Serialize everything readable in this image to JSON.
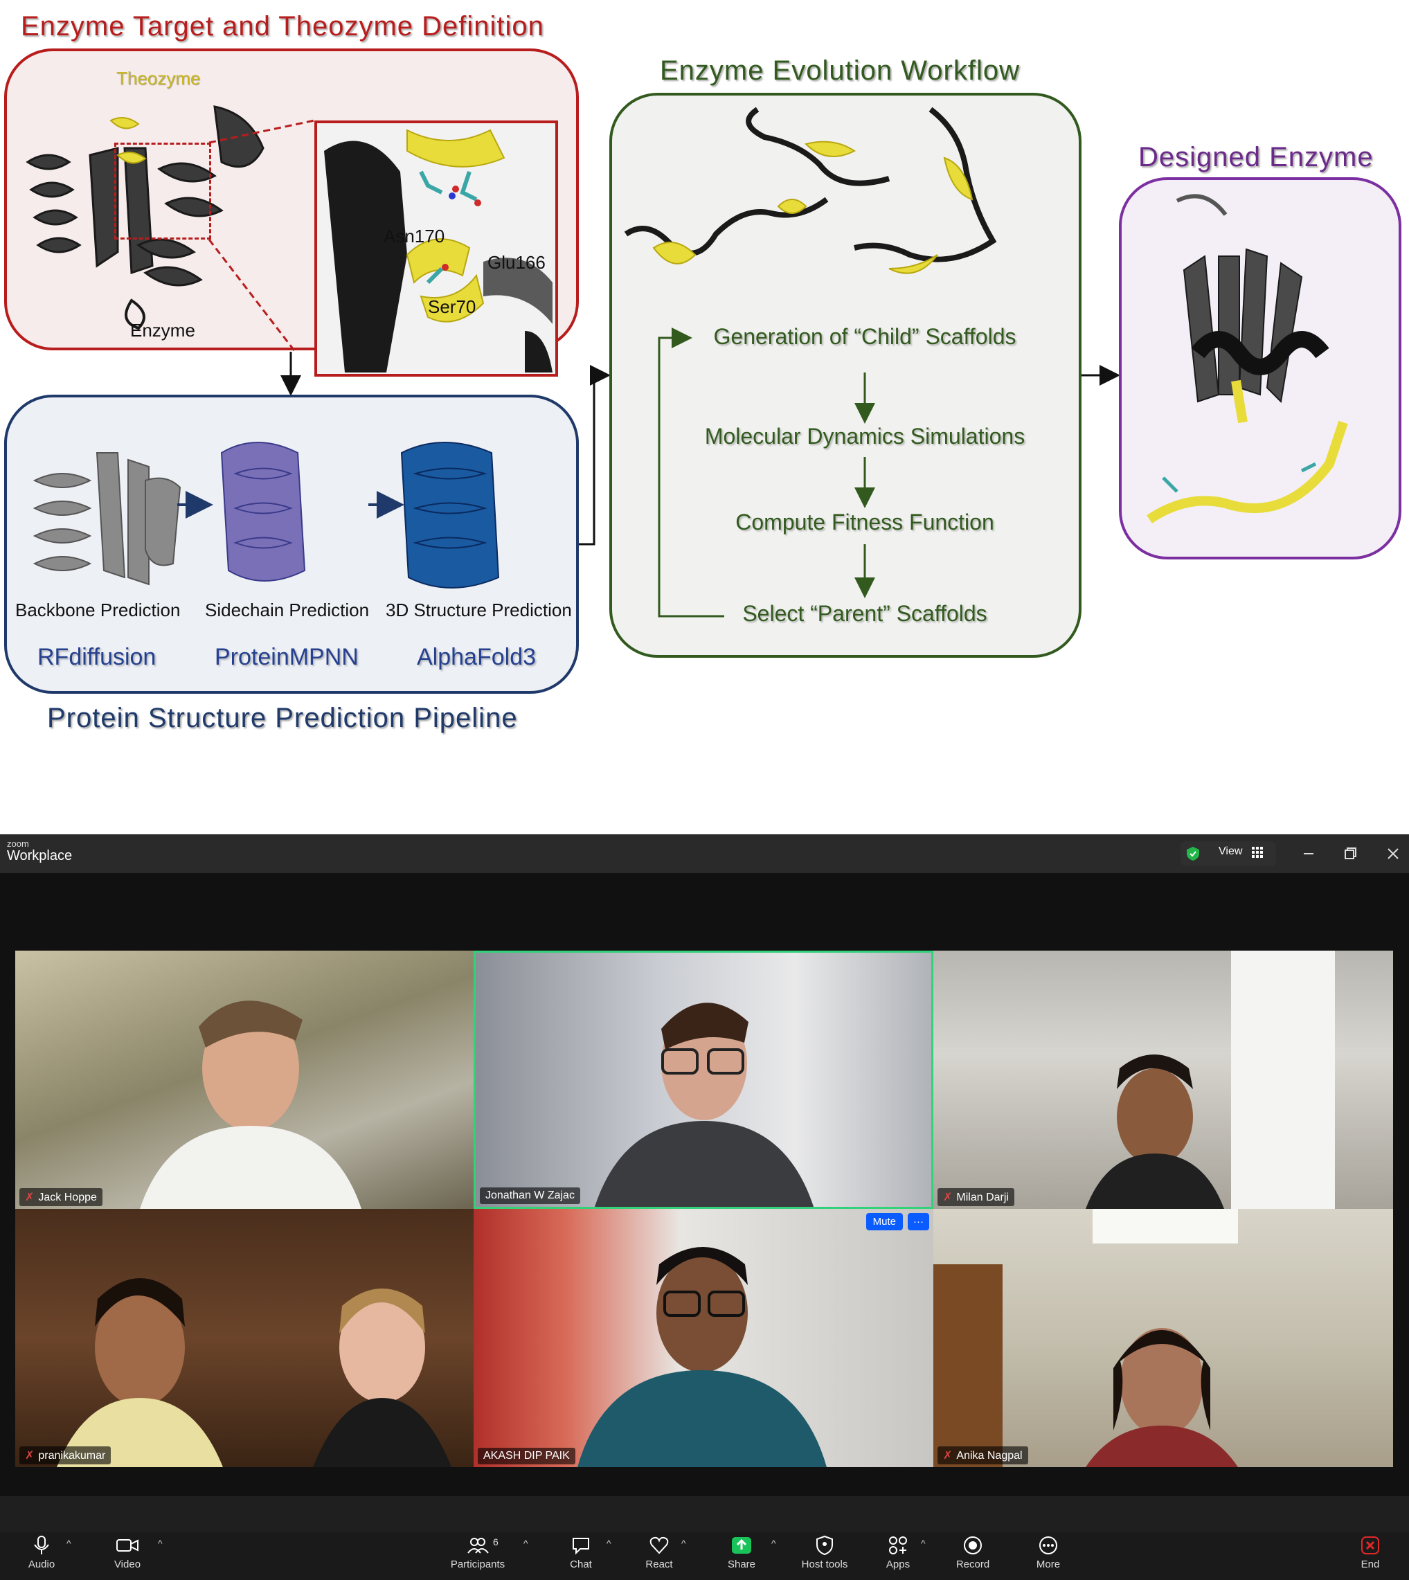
{
  "figure": {
    "target": {
      "title": "Enzyme Target and Theozyme Definition",
      "theozyme_label": "Theozyme",
      "enzyme_label": "Enzyme",
      "residues": [
        "Asn170",
        "Glu166",
        "Ser70"
      ]
    },
    "pipeline": {
      "title": "Protein Structure Prediction Pipeline",
      "stages": [
        {
          "label": "Backbone Prediction",
          "tool": "RFdiffusion"
        },
        {
          "label": "Sidechain Prediction",
          "tool": "ProteinMPNN"
        },
        {
          "label": "3D Structure Prediction",
          "tool": "AlphaFold3"
        }
      ]
    },
    "evolution": {
      "title": "Enzyme Evolution Workflow",
      "steps": [
        "Generation of “Child” Scaffolds",
        "Molecular Dynamics Simulations",
        "Compute Fitness Function",
        "Select “Parent” Scaffolds"
      ]
    },
    "designed": {
      "title": "Designed Enzyme"
    }
  },
  "zoom": {
    "brand_small": "zoom",
    "brand": "Workplace",
    "view_label": "View",
    "participants": [
      {
        "name": "Jack Hoppe",
        "muted": true,
        "active": false
      },
      {
        "name": "Jonathan W Zajac",
        "muted": false,
        "active": true
      },
      {
        "name": "Milan Darji",
        "muted": true,
        "active": false
      },
      {
        "name": "pranikakumar",
        "muted": true,
        "active": false
      },
      {
        "name": "AKASH DIP PAIK",
        "muted": false,
        "active": false
      },
      {
        "name": "Anika Nagpal",
        "muted": true,
        "active": false
      }
    ],
    "tile_controls": {
      "mute": "Mute",
      "more": "···"
    },
    "toolbar": {
      "audio": "Audio",
      "video": "Video",
      "participants": "Participants",
      "participants_count": "6",
      "chat": "Chat",
      "react": "React",
      "share": "Share",
      "host_tools": "Host tools",
      "apps": "Apps",
      "record": "Record",
      "more": "More",
      "end": "End"
    },
    "colors": {
      "active_border": "#33d17a",
      "share_green": "#18c45a",
      "end_red": "#e02828",
      "mute_blue": "#0b5cff"
    }
  }
}
